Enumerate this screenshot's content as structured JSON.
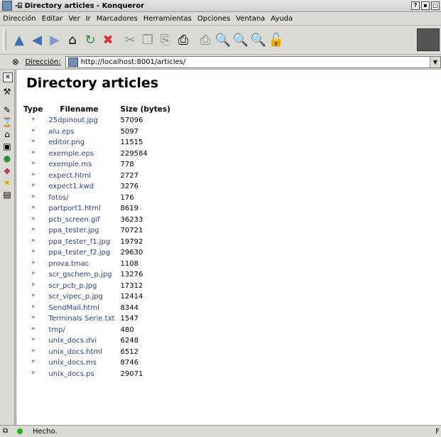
{
  "window": {
    "title": "-⍄ Directory articles - Konqueror",
    "help": "?",
    "min": "▪",
    "max": "□"
  },
  "menu": [
    "Dirección",
    "Editar",
    "Ver",
    "Ir",
    "Marcadores",
    "Herramientas",
    "Opciones",
    "Ventana",
    "Ayuda"
  ],
  "location": {
    "label": "Dirección:",
    "url": "http://localhost:8001/articles/"
  },
  "page": {
    "heading": "Directory articles",
    "columns": [
      "Type",
      "Filename",
      "Size (bytes)"
    ],
    "bullet": "*",
    "files": [
      {
        "name": "25dpinout.jpg",
        "size": "57096"
      },
      {
        "name": "alu.eps",
        "size": "5097"
      },
      {
        "name": "editor.png",
        "size": "11515"
      },
      {
        "name": "exemple.eps",
        "size": "229584"
      },
      {
        "name": "exemple.ms",
        "size": "778"
      },
      {
        "name": "expect.html",
        "size": "2727"
      },
      {
        "name": "expect1.kwd",
        "size": "3276"
      },
      {
        "name": "fotos/",
        "size": "176"
      },
      {
        "name": "partport1.html",
        "size": "8619"
      },
      {
        "name": "pcb_screen.gif",
        "size": "36233"
      },
      {
        "name": "ppa_tester.jpg",
        "size": "70721"
      },
      {
        "name": "ppa_tester_f1.jpg",
        "size": "19792"
      },
      {
        "name": "ppa_tester_f2.jpg",
        "size": "29630"
      },
      {
        "name": "prova.tmac",
        "size": "1108"
      },
      {
        "name": "scr_gschem_p.jpg",
        "size": "13276"
      },
      {
        "name": "scr_pcb_p.jpg",
        "size": "17312"
      },
      {
        "name": "scr_vipec_p.jpg",
        "size": "12414"
      },
      {
        "name": "SendMail.html",
        "size": "8344"
      },
      {
        "name": "Terminals Serie.txt",
        "size": "1547"
      },
      {
        "name": "tmp/",
        "size": "480"
      },
      {
        "name": "unix_docs.dvi",
        "size": "6248"
      },
      {
        "name": "unix_docs.html",
        "size": "6512"
      },
      {
        "name": "unix_docs.ms",
        "size": "8746"
      },
      {
        "name": "unix_docs.ps",
        "size": "29071"
      }
    ]
  },
  "status": {
    "text": "Hecho.",
    "right": "F"
  }
}
